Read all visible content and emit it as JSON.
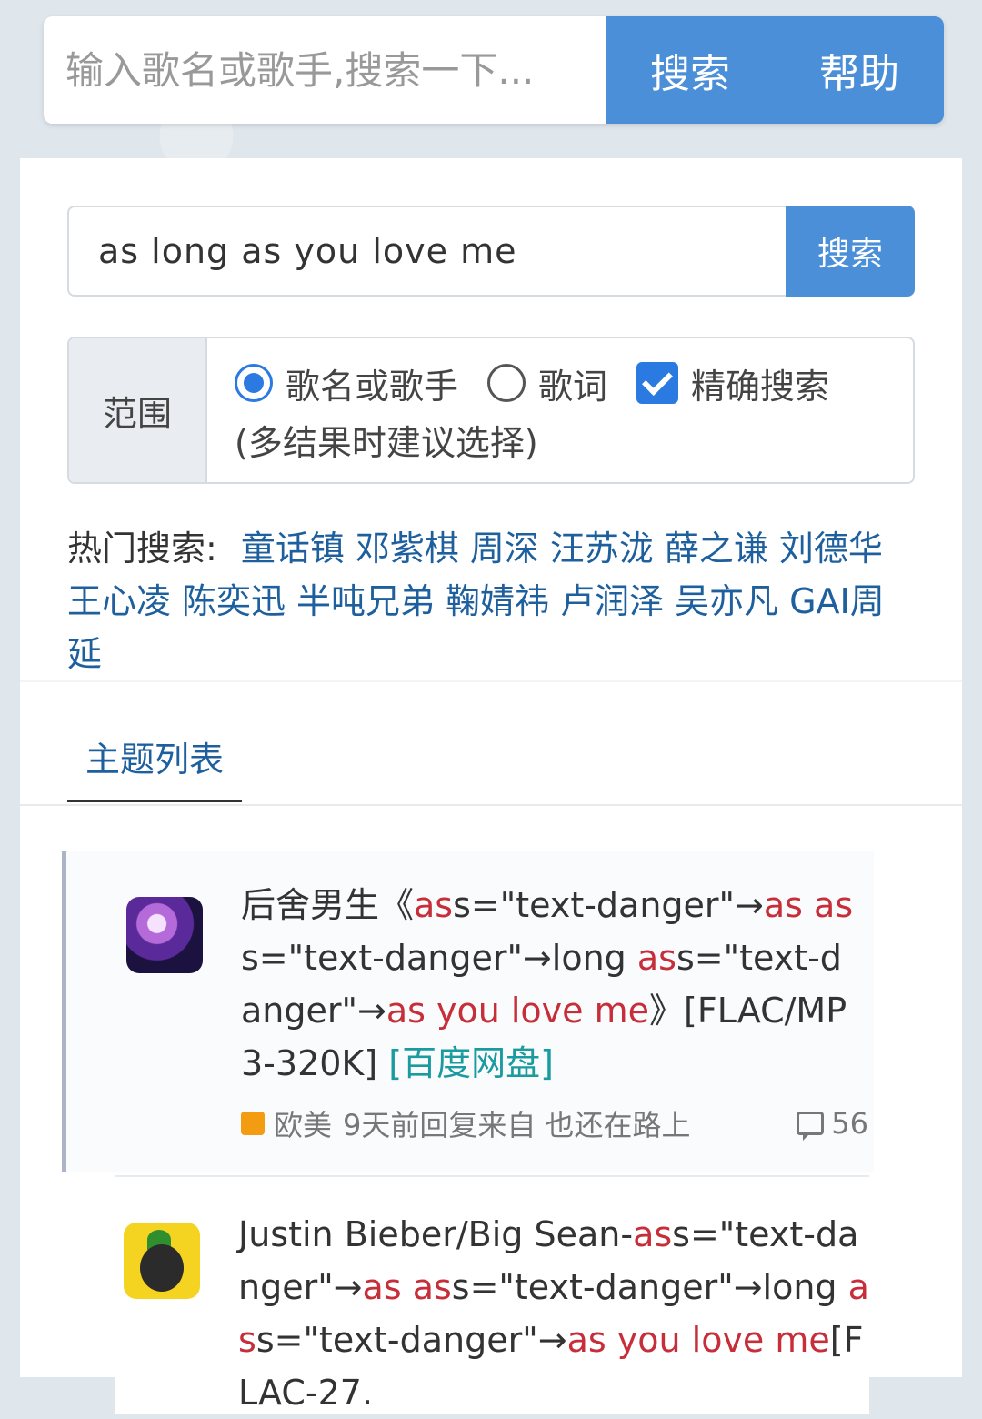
{
  "top_search": {
    "placeholder": "输入歌名或歌手,搜索一下...",
    "search_label": "搜索",
    "help_label": "帮助"
  },
  "query": {
    "value": "as long as you love me",
    "button_label": "搜索"
  },
  "scope": {
    "label": "范围",
    "options": [
      {
        "label": "歌名或歌手",
        "selected": true
      },
      {
        "label": "歌词",
        "selected": false
      }
    ],
    "exact": {
      "label": "精确搜索",
      "checked": true
    },
    "note": "(多结果时建议选择)"
  },
  "hot": {
    "label": "热门搜索:",
    "keywords": [
      "童话镇",
      "邓紫棋",
      "周深",
      "汪苏泷",
      "薛之谦",
      "刘德华",
      "王心凌",
      "陈奕迅",
      "半吨兄弟",
      "鞠婧祎",
      "卢润泽",
      "吴亦凡",
      "GAI周延"
    ]
  },
  "tabs": [
    {
      "label": "主题列表",
      "active": true
    }
  ],
  "threads": [
    {
      "title_parts": [
        {
          "text": "后舍男生《",
          "style": "normal"
        },
        {
          "text": "as",
          "style": "red"
        },
        {
          "text": "s=\"text-danger\"→",
          "style": "normal"
        },
        {
          "text": "as as",
          "style": "red"
        },
        {
          "text": "s=\"text-danger\"→long ",
          "style": "normal"
        },
        {
          "text": "as",
          "style": "red"
        },
        {
          "text": "s=\"text-danger\"→",
          "style": "normal"
        },
        {
          "text": "as you love me",
          "style": "red"
        },
        {
          "text": "》[FLAC/MP3-320K] ",
          "style": "normal"
        },
        {
          "text": "[百度网盘]",
          "style": "teal"
        }
      ],
      "category": "欧美",
      "meta_text": "9天前回复来自 也还在路上",
      "reply_count": "56",
      "tag_color": "#f39c12"
    },
    {
      "title_parts": [
        {
          "text": "Justin Bieber/Big Sean-",
          "style": "normal"
        },
        {
          "text": "as",
          "style": "red"
        },
        {
          "text": "s=\"text-danger\"→",
          "style": "normal"
        },
        {
          "text": "as as",
          "style": "red"
        },
        {
          "text": "s=\"text-danger\"→long ",
          "style": "normal"
        },
        {
          "text": "as",
          "style": "red"
        },
        {
          "text": "s=\"text-danger\"→",
          "style": "normal"
        },
        {
          "text": "as you love me",
          "style": "red"
        },
        {
          "text": "[FLAC-27.",
          "style": "normal"
        }
      ]
    }
  ],
  "colors": {
    "primary": "#4a8fd8",
    "link": "#1e5f9e",
    "danger": "#c62f3a",
    "netdisk": "#1a9ba0"
  }
}
